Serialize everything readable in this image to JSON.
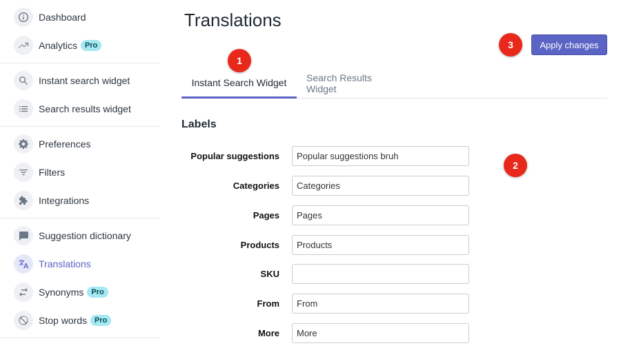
{
  "sidebar": {
    "groups": [
      {
        "items": [
          {
            "label": "Dashboard",
            "icon": "info-icon",
            "pro": null
          },
          {
            "label": "Analytics",
            "icon": "trending-up-icon",
            "pro": "Pro"
          }
        ]
      },
      {
        "items": [
          {
            "label": "Instant search widget",
            "icon": "search-icon",
            "pro": null
          },
          {
            "label": "Search results widget",
            "icon": "list-icon",
            "pro": null
          }
        ]
      },
      {
        "items": [
          {
            "label": "Preferences",
            "icon": "gear-icon",
            "pro": null
          },
          {
            "label": "Filters",
            "icon": "filter-icon",
            "pro": null
          },
          {
            "label": "Integrations",
            "icon": "puzzle-icon",
            "pro": null
          }
        ]
      },
      {
        "items": [
          {
            "label": "Suggestion dictionary",
            "icon": "chat-icon",
            "pro": null
          },
          {
            "label": "Translations",
            "icon": "translate-icon",
            "pro": null,
            "active": true
          },
          {
            "label": "Synonyms",
            "icon": "swap-icon",
            "pro": "Pro"
          },
          {
            "label": "Stop words",
            "icon": "block-icon",
            "pro": "Pro"
          }
        ]
      }
    ]
  },
  "header": {
    "title": "Translations",
    "apply_label": "Apply changes"
  },
  "markers": {
    "one": "1",
    "two": "2",
    "three": "3"
  },
  "tabs": [
    {
      "label": "Instant Search Widget",
      "active": true
    },
    {
      "label": "Search Results Widget",
      "active": false
    }
  ],
  "section": {
    "title": "Labels"
  },
  "fields": [
    {
      "label": "Popular suggestions",
      "value": "Popular suggestions bruh"
    },
    {
      "label": "Categories",
      "value": "Categories"
    },
    {
      "label": "Pages",
      "value": "Pages"
    },
    {
      "label": "Products",
      "value": "Products"
    },
    {
      "label": "SKU",
      "value": ""
    },
    {
      "label": "From",
      "value": "From"
    },
    {
      "label": "More",
      "value": "More"
    }
  ],
  "colors": {
    "accent": "#5b63c4",
    "marker": "#e8281a",
    "pro_badge": "#a4e8f2"
  }
}
